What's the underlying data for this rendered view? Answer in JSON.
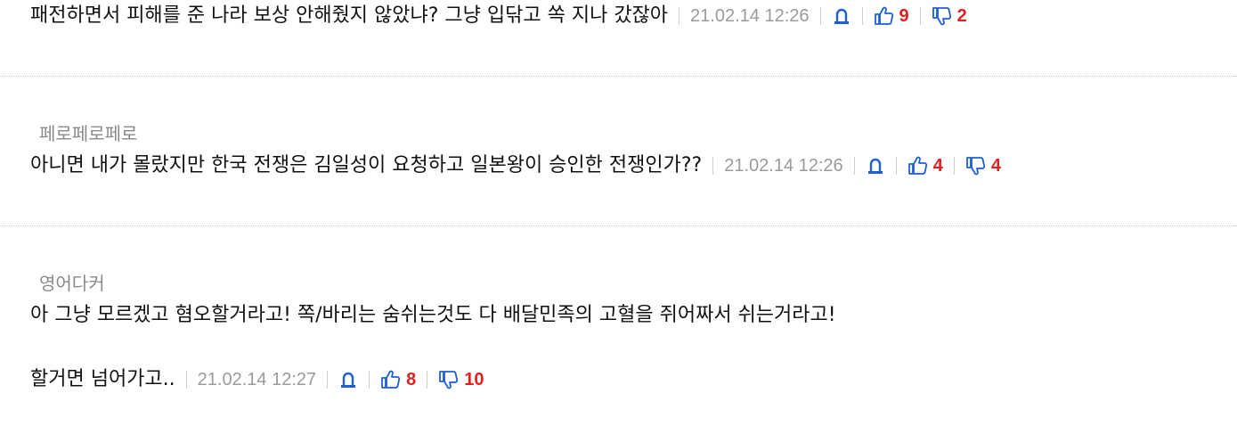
{
  "comments": [
    {
      "author": "",
      "text": "패전하면서 피해를 준 나라 보상 안해줬지 않았냐? 그냥 입닦고 쏙 지나 갔잖아",
      "date": "21.02.14 12:26",
      "likes": "9",
      "dislikes": "2"
    },
    {
      "author": "페로페로페로",
      "text": "아니면 내가 몰랐지만 한국 전쟁은 김일성이 요청하고 일본왕이 승인한 전쟁인가??",
      "date": "21.02.14 12:26",
      "likes": "4",
      "dislikes": "4"
    },
    {
      "author": "영어다커",
      "text": "아 그냥 모르겠고 혐오할거라고! 쪽/바리는 숨쉬는것도 다 배달민족의 고혈을 쥐어짜서 쉬는거라고!",
      "text2": "할거면 넘어가고..",
      "date": "21.02.14 12:27",
      "likes": "8",
      "dislikes": "10"
    }
  ],
  "icons": {
    "report": "report-bell-icon",
    "like": "thumbs-up-icon",
    "dislike": "thumbs-down-icon"
  },
  "colors": {
    "count": "#e02020",
    "icon": "#1f5fd6",
    "date": "#9a9a9a",
    "author": "#8a8a8a"
  }
}
